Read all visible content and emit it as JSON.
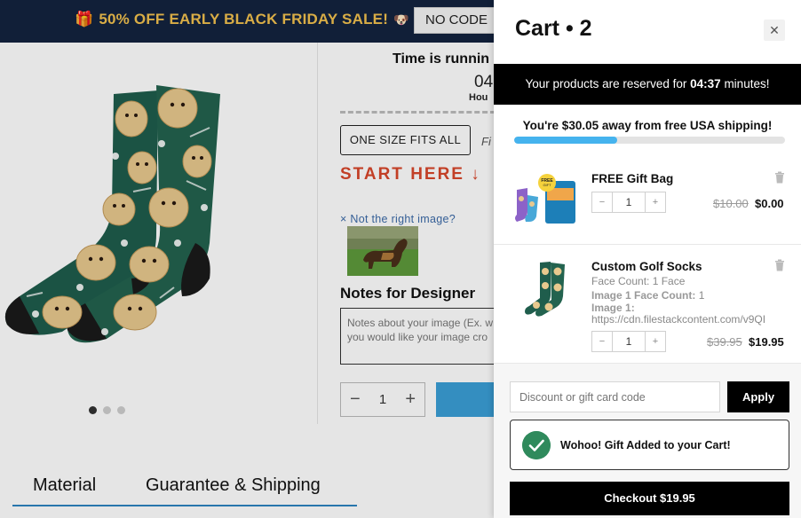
{
  "promo": {
    "text": "50% OFF EARLY BLACK FRIDAY SALE!",
    "gift_icon": "gift-icon",
    "dog_icon": "dog-icon",
    "code_label": "NO CODE"
  },
  "product": {
    "timer_title": "Time is runnin",
    "timer_value": "04",
    "timer_unit": "Hou",
    "size_option": "ONE SIZE FITS ALL",
    "size_side_text": "Fi",
    "start_here": "START HERE",
    "not_right_image": "Not the right image?",
    "notes_label": "Notes for Designer",
    "notes_placeholder_line1": "Notes about your image (Ex. w",
    "notes_placeholder_line2": "you would like your image cro",
    "quantity": "1",
    "carousel_dots": 3,
    "carousel_active": 0
  },
  "tabs": {
    "material": "Material",
    "guarantee": "Guarantee & Shipping"
  },
  "cart": {
    "title": "Cart • 2",
    "close_icon": "close-icon",
    "reserve_prefix": "Your products are reserved for",
    "reserve_time": "04:37",
    "reserve_suffix": "minutes!",
    "shipping_text": "You're $30.05 away from free USA shipping!",
    "shipping_progress": 0.38,
    "items": [
      {
        "name": "FREE Gift Bag",
        "quantity": "1",
        "price_old": "$10.00",
        "price_new": "$0.00"
      },
      {
        "name": "Custom Golf Socks",
        "face_count_label": "Face Count:",
        "face_count_value": "1 Face",
        "image_face_count_label": "Image 1 Face Count:",
        "image_face_count_value": "1",
        "image_label": "Image 1:",
        "image_url": "https://cdn.filestackcontent.com/v9QI",
        "quantity": "1",
        "price_old": "$39.95",
        "price_new": "$19.95"
      }
    ],
    "discount_placeholder": "Discount or gift card code",
    "apply_label": "Apply",
    "gift_added_text": "Wohoo! Gift Added to your Cart!",
    "checkout_label": "Checkout $19.95"
  },
  "colors": {
    "promo_bg": "#13233f",
    "promo_text": "#f2c14e",
    "start_here": "#d9472b",
    "progress_fill": "#45b3ee",
    "success_green": "#2f8a5c",
    "link_blue": "#3b6aa8"
  }
}
